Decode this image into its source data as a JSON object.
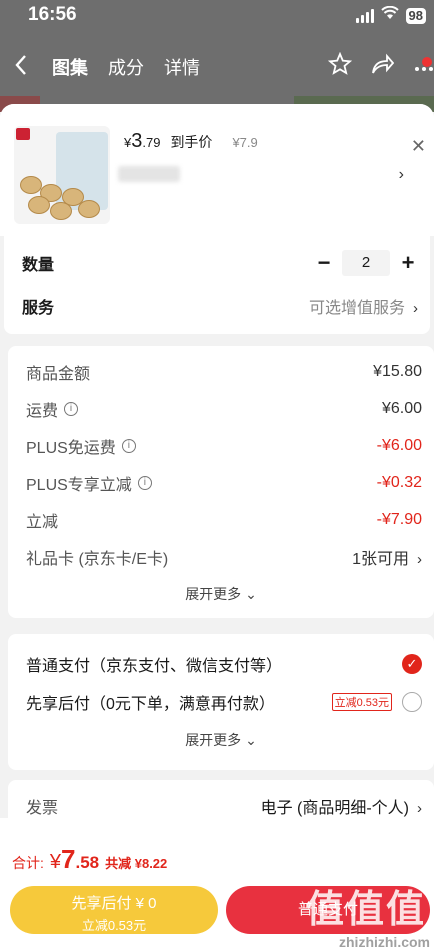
{
  "status_bar": {
    "time": "16:56",
    "battery": "98"
  },
  "nav": {
    "tabs": [
      "图集",
      "成分",
      "详情"
    ]
  },
  "product": {
    "currency": "¥",
    "price_int": "3",
    "price_dec": ".79",
    "price_tag": "到手价",
    "original_price": "¥7.9"
  },
  "quantity": {
    "label": "数量",
    "value": "2",
    "minus": "−",
    "plus": "+"
  },
  "service": {
    "label": "服务",
    "value": "可选增值服务"
  },
  "fees": [
    {
      "label": "商品金额",
      "value": "¥15.80",
      "info": false,
      "highlight": false
    },
    {
      "label": "运费",
      "value": "¥6.00",
      "info": true,
      "highlight": false
    },
    {
      "label": "PLUS免运费",
      "value": "-¥6.00",
      "info": true,
      "highlight": true
    },
    {
      "label": "PLUS专享立减",
      "value": "-¥0.32",
      "info": true,
      "highlight": true
    },
    {
      "label": "立减",
      "value": "-¥7.90",
      "info": false,
      "highlight": true
    },
    {
      "label": "礼品卡 (京东卡/E卡)",
      "value": "1张可用",
      "info": false,
      "highlight": false
    }
  ],
  "fees_expand": "展开更多",
  "payment": {
    "options": [
      {
        "label": "普通支付（京东支付、微信支付等）",
        "promo": "",
        "selected": true
      },
      {
        "label": "先享后付（0元下单，满意再付款）",
        "promo": "立减0.53元",
        "selected": false
      }
    ],
    "expand": "展开更多"
  },
  "invoice": {
    "label": "发票",
    "value": "电子 (商品明细-个人)"
  },
  "footer": {
    "total_label": "合计:",
    "currency": "¥",
    "total_int": "7",
    "total_dec": ".58",
    "saved": "共减 ¥8.22",
    "left_button_line1": "先享后付 ¥ 0",
    "left_button_line2": "立减0.53元",
    "right_button": "普通支付"
  },
  "watermark": {
    "text": "值值值",
    "sub": "zhizhizhi.com"
  },
  "colors": {
    "accent": "#e1251b",
    "yellow_button": "#f6c93b",
    "red_button": "#e8313f"
  }
}
